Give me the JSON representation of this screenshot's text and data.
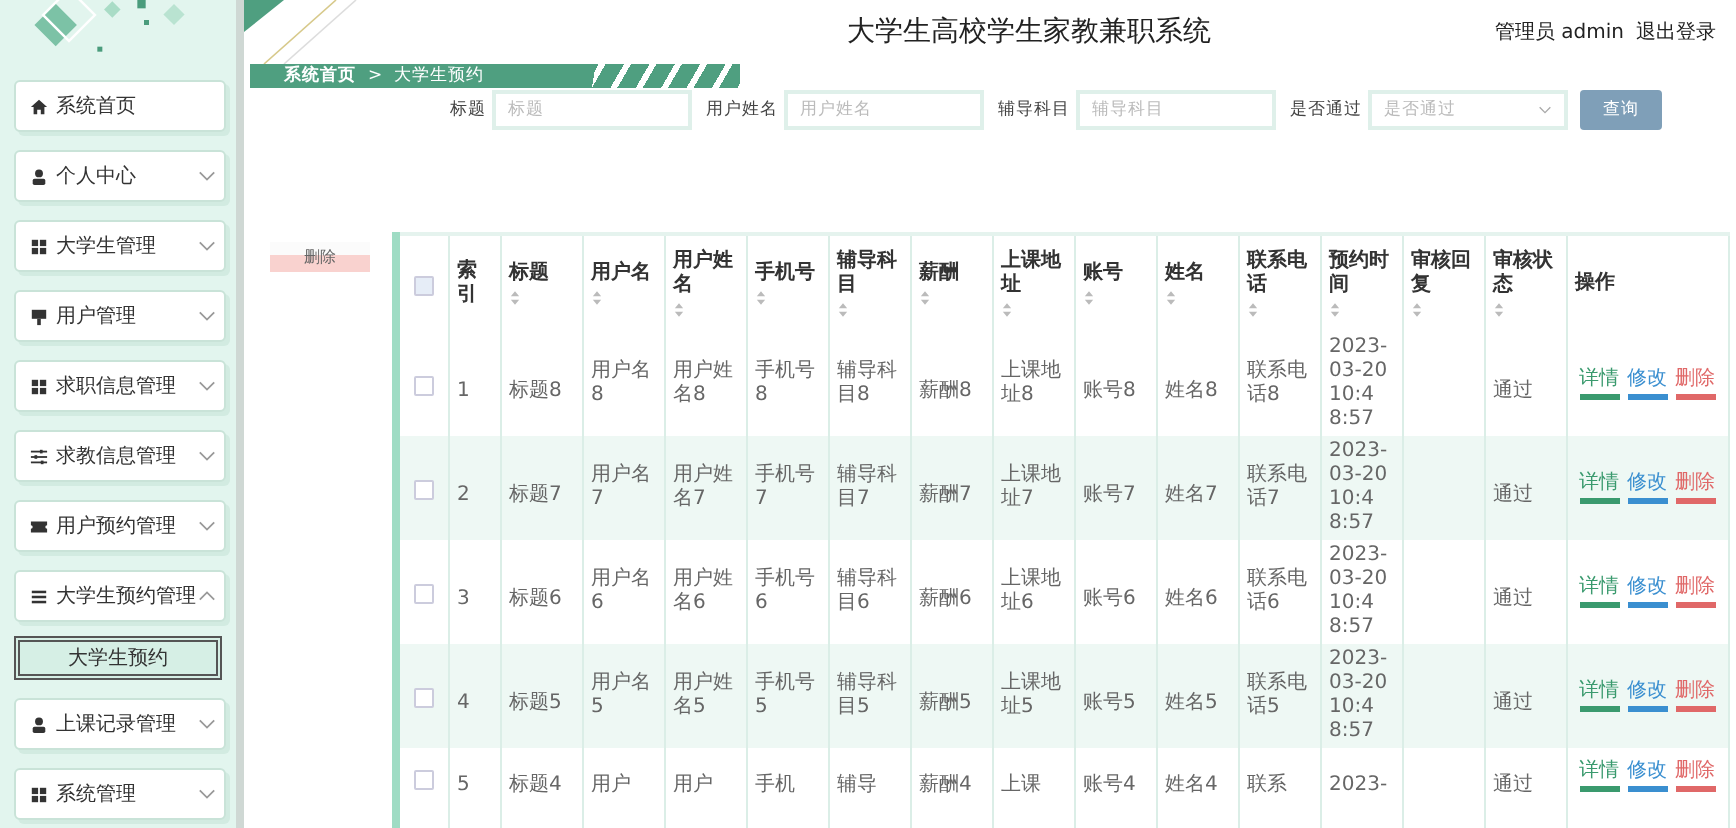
{
  "header": {
    "title": "大学生高校学生家教兼职系统",
    "user": "管理员 admin",
    "logout": "退出登录"
  },
  "sidebar": {
    "items": [
      {
        "label": "系统首页",
        "kind": "link"
      },
      {
        "label": "个人中心",
        "kind": "menu",
        "expanded": false
      },
      {
        "label": "大学生管理",
        "kind": "menu",
        "expanded": false
      },
      {
        "label": "用户管理",
        "kind": "menu",
        "expanded": false
      },
      {
        "label": "求职信息管理",
        "kind": "menu",
        "expanded": false
      },
      {
        "label": "求教信息管理",
        "kind": "menu",
        "expanded": false
      },
      {
        "label": "用户预约管理",
        "kind": "menu",
        "expanded": false
      },
      {
        "label": "大学生预约管理",
        "kind": "menu",
        "expanded": true,
        "children": [
          {
            "label": "大学生预约",
            "selected": true
          }
        ]
      },
      {
        "label": "上课记录管理",
        "kind": "menu",
        "expanded": false
      },
      {
        "label": "系统管理",
        "kind": "menu",
        "expanded": false
      }
    ]
  },
  "breadcrumb": [
    "系统首页",
    ">",
    "大学生预约"
  ],
  "search": {
    "fields": [
      {
        "label": "标题",
        "placeholder": "标题",
        "kind": "input"
      },
      {
        "label": "用户姓名",
        "placeholder": "用户姓名",
        "kind": "input"
      },
      {
        "label": "辅导科目",
        "placeholder": "辅导科目",
        "kind": "input"
      },
      {
        "label": "是否通过",
        "placeholder": "是否通过",
        "kind": "select"
      }
    ],
    "button": "查询"
  },
  "delete_button": "删除",
  "table": {
    "select_all_checked": false,
    "columns": [
      {
        "label": "索引",
        "sortable": false
      },
      {
        "label": "标题",
        "sortable": true
      },
      {
        "label": "用户名",
        "sortable": true
      },
      {
        "label": "用户姓名",
        "sortable": true
      },
      {
        "label": "手机号",
        "sortable": true
      },
      {
        "label": "辅导科目",
        "sortable": true
      },
      {
        "label": "薪酬",
        "sortable": true
      },
      {
        "label": "上课地址",
        "sortable": true
      },
      {
        "label": "账号",
        "sortable": true
      },
      {
        "label": "姓名",
        "sortable": true
      },
      {
        "label": "联系电话",
        "sortable": true
      },
      {
        "label": "预约时间",
        "sortable": true
      },
      {
        "label": "审核回复",
        "sortable": true
      },
      {
        "label": "审核状态",
        "sortable": true
      },
      {
        "label": "操作",
        "sortable": false
      }
    ],
    "rows": [
      {
        "checked": false,
        "cells": [
          "1",
          "标题8",
          "用户名8",
          "用户姓名8",
          "手机号8",
          "辅导科目8",
          "薪酬8",
          "上课地址8",
          "账号8",
          "姓名8",
          "联系电话8",
          "2023-03-20 10:48:57",
          null,
          "通过"
        ],
        "actions": [
          {
            "label": "详情",
            "kind": "view"
          },
          {
            "label": "修改",
            "kind": "edit"
          },
          {
            "label": "删除",
            "kind": "delete"
          }
        ]
      },
      {
        "checked": false,
        "cells": [
          "2",
          "标题7",
          "用户名7",
          "用户姓名7",
          "手机号7",
          "辅导科目7",
          "薪酬7",
          "上课地址7",
          "账号7",
          "姓名7",
          "联系电话7",
          "2023-03-20 10:48:57",
          null,
          "通过"
        ],
        "actions": [
          {
            "label": "详情",
            "kind": "view"
          },
          {
            "label": "修改",
            "kind": "edit"
          },
          {
            "label": "删除",
            "kind": "delete"
          }
        ]
      },
      {
        "checked": false,
        "cells": [
          "3",
          "标题6",
          "用户名6",
          "用户姓名6",
          "手机号6",
          "辅导科目6",
          "薪酬6",
          "上课地址6",
          "账号6",
          "姓名6",
          "联系电话6",
          "2023-03-20 10:48:57",
          null,
          "通过"
        ],
        "actions": [
          {
            "label": "详情",
            "kind": "view"
          },
          {
            "label": "修改",
            "kind": "edit"
          },
          {
            "label": "删除",
            "kind": "delete"
          }
        ]
      },
      {
        "checked": false,
        "cells": [
          "4",
          "标题5",
          "用户名5",
          "用户姓名5",
          "手机号5",
          "辅导科目5",
          "薪酬5",
          "上课地址5",
          "账号5",
          "姓名5",
          "联系电话5",
          "2023-03-20 10:48:57",
          null,
          "通过"
        ],
        "actions": [
          {
            "label": "详情",
            "kind": "view"
          },
          {
            "label": "修改",
            "kind": "edit"
          },
          {
            "label": "删除",
            "kind": "delete"
          }
        ]
      },
      {
        "checked": false,
        "cells": [
          "5",
          "标题4",
          "用户",
          "用户",
          "手机",
          "辅导",
          "薪酬4",
          "上课",
          "账号4",
          "姓名4",
          "联系",
          "2023-",
          null,
          "通过"
        ],
        "actions": [
          {
            "label": "详情",
            "kind": "view"
          },
          {
            "label": "修改",
            "kind": "edit"
          },
          {
            "label": "删除",
            "kind": "delete"
          }
        ]
      }
    ]
  }
}
